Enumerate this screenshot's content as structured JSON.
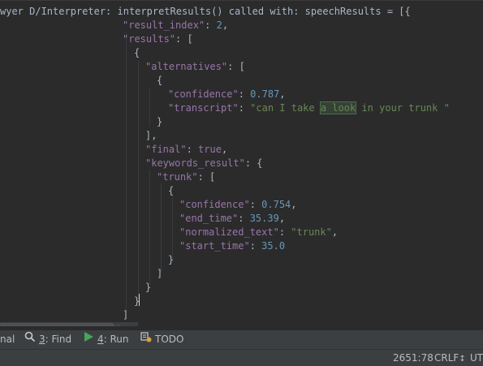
{
  "editor": {
    "lines": [
      [
        {
          "c": "t",
          "v": "wyer D/Interpreter: interpretResults() called with: speechResults = [{"
        }
      ],
      [
        {
          "c": "k",
          "v": "\"result_index\""
        },
        {
          "c": "p",
          "v": ": "
        },
        {
          "c": "n",
          "v": "2"
        },
        {
          "c": "p",
          "v": ","
        }
      ],
      [
        {
          "c": "k",
          "v": "\"results\""
        },
        {
          "c": "p",
          "v": ": ["
        }
      ],
      [
        {
          "c": "p",
          "v": "{"
        }
      ],
      [
        {
          "c": "k",
          "v": "\"alternatives\""
        },
        {
          "c": "p",
          "v": ": ["
        }
      ],
      [
        {
          "c": "p",
          "v": "{"
        }
      ],
      [
        {
          "c": "k",
          "v": "\"confidence\""
        },
        {
          "c": "p",
          "v": ": "
        },
        {
          "c": "n",
          "v": "0.787"
        },
        {
          "c": "p",
          "v": ","
        }
      ],
      [
        {
          "c": "k",
          "v": "\"transcript\""
        },
        {
          "c": "p",
          "v": ": "
        },
        {
          "c": "s",
          "v": "\"can I take "
        },
        {
          "c": "hl",
          "v": "a look"
        },
        {
          "c": "s",
          "v": " in your trunk \""
        }
      ],
      [
        {
          "c": "p",
          "v": "}"
        }
      ],
      [
        {
          "c": "p",
          "v": "],"
        }
      ],
      [
        {
          "c": "k",
          "v": "\"final\""
        },
        {
          "c": "p",
          "v": ": "
        },
        {
          "c": "k",
          "v": "true"
        },
        {
          "c": "p",
          "v": ","
        }
      ],
      [
        {
          "c": "k",
          "v": "\"keywords_result\""
        },
        {
          "c": "p",
          "v": ": {"
        }
      ],
      [
        {
          "c": "k",
          "v": "\"trunk\""
        },
        {
          "c": "p",
          "v": ": ["
        }
      ],
      [
        {
          "c": "p",
          "v": "{"
        }
      ],
      [
        {
          "c": "k",
          "v": "\"confidence\""
        },
        {
          "c": "p",
          "v": ": "
        },
        {
          "c": "n",
          "v": "0.754"
        },
        {
          "c": "p",
          "v": ","
        }
      ],
      [
        {
          "c": "k",
          "v": "\"end_time\""
        },
        {
          "c": "p",
          "v": ": "
        },
        {
          "c": "n",
          "v": "35.39"
        },
        {
          "c": "p",
          "v": ","
        }
      ],
      [
        {
          "c": "k",
          "v": "\"normalized_text\""
        },
        {
          "c": "p",
          "v": ": "
        },
        {
          "c": "s",
          "v": "\"trunk\""
        },
        {
          "c": "p",
          "v": ","
        }
      ],
      [
        {
          "c": "k",
          "v": "\"start_time\""
        },
        {
          "c": "p",
          "v": ": "
        },
        {
          "c": "n",
          "v": "35.0"
        }
      ],
      [
        {
          "c": "p",
          "v": "}"
        }
      ],
      [
        {
          "c": "p",
          "v": "]"
        }
      ],
      [
        {
          "c": "p",
          "v": "}"
        }
      ],
      [
        {
          "c": "p",
          "v": "}"
        }
      ],
      [
        {
          "c": "p",
          "v": "]"
        }
      ]
    ],
    "colors": {
      "background": "#2b2b2b",
      "key": "#9876aa",
      "string": "#6a8759",
      "number": "#6897bb",
      "punct": "#a9b7c6",
      "highlight": "#344134"
    }
  },
  "toolwindows": {
    "terminal_label": "nal",
    "find_key": "3",
    "find_label": ": Find",
    "find_icon": "search-icon",
    "run_key": "4",
    "run_label": ": Run",
    "run_icon": "play-icon",
    "todo_label": "TODO",
    "todo_icon": "todo-icon"
  },
  "statusbar": {
    "position": "2651:78",
    "line_separator": "CRLF",
    "line_separator_arrow": "↕",
    "encoding": "UT"
  }
}
